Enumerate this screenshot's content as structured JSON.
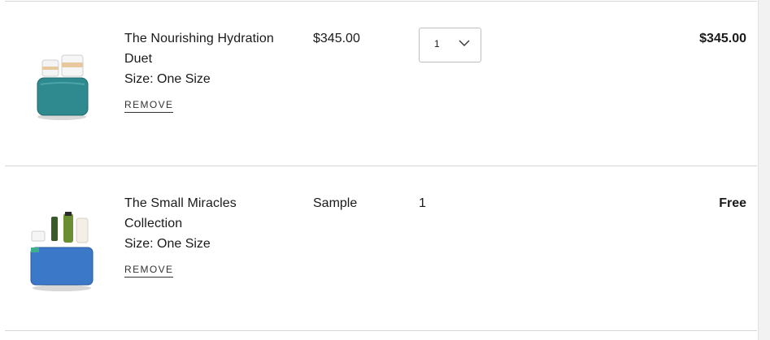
{
  "cart": {
    "items": [
      {
        "name": "The Nourishing Hydration Duet",
        "size": "Size: One Size",
        "remove_label": "REMOVE",
        "price": "$345.00",
        "quantity": "1",
        "total": "$345.00",
        "image_icon": "skincare-set-teal-pouch-icon"
      },
      {
        "name": "The Small Miracles Collection",
        "size": "Size: One Size",
        "remove_label": "REMOVE",
        "price": "Sample",
        "quantity": "1",
        "total": "Free",
        "image_icon": "skincare-set-blue-pouch-icon"
      }
    ]
  },
  "colors": {
    "teal_pouch": "#2f8a8f",
    "blue_pouch": "#3b78c8",
    "divider": "#d6d6d6"
  }
}
